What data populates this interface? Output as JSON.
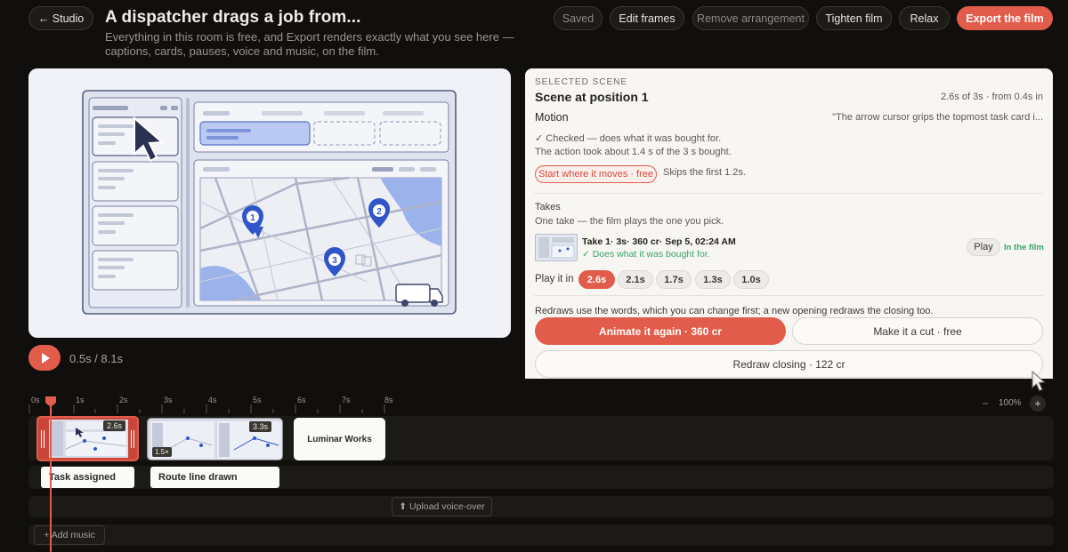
{
  "header": {
    "back_label": "← Studio",
    "title": "A dispatcher drags a job from...",
    "subtitle": "Everything in this room is free, and Export renders exactly what you see here — captions, cards, pauses, voice and music, on the film.",
    "buttons": {
      "saved": "Saved",
      "edit_frames": "Edit frames",
      "remove_arrangement": "Remove arrangement",
      "tighten_film": "Tighten film",
      "relax": "Relax",
      "export": "Export the film"
    }
  },
  "player": {
    "time": "0.5s / 8.1s",
    "map_pins": [
      "1",
      "2",
      "3"
    ]
  },
  "panel": {
    "eyebrow": "SELECTED SCENE",
    "scene_title": "Scene at position 1",
    "scene_meta": "2.6s of 3s · from 0.4s in",
    "motion_label": "Motion",
    "motion_quote": "\"The arrow cursor grips the topmost task card i...",
    "checked": "✓ Checked — does what it was bought for.",
    "action_note": "The action took about 1.4 s of the 3 s bought.",
    "start_where": "Start where it moves · free",
    "skips": "Skips the first 1.2s.",
    "takes_label": "Takes",
    "takes_note": "One take — the film plays the one you pick.",
    "take_title": "Take 1· 3s· 360 cr· Sep 5, 02:24 AM",
    "take_status": "✓ Does what it was bought for.",
    "take_play": "Play",
    "take_in_film": "In the film",
    "play_it_in_label": "Play it in",
    "durations": [
      "2.6s",
      "2.1s",
      "1.7s",
      "1.3s",
      "1.0s"
    ],
    "selected_duration": "2.6s",
    "redraw_note": "Redraws use the words, which you can change first; a new opening redraws the closing too.",
    "animate_again": "Animate it again · 360 cr",
    "make_cut": "Make it a cut · free",
    "redraw_closing": "Redraw closing · 122 cr"
  },
  "timeline": {
    "ticks": [
      "0s",
      "1s",
      "2s",
      "3s",
      "4s",
      "5s",
      "6s",
      "7s",
      "8s"
    ],
    "zoom": "100%",
    "zoom_minus": "−",
    "zoom_plus": "+",
    "clip1_duration": "2.6s",
    "clip2_duration": "3.3s",
    "clip2_speed": "1.5×",
    "card_text": "Luminar Works",
    "captions": [
      "Task assigned",
      "Route line drawn"
    ],
    "upload_voice": "⬆ Upload voice-over",
    "add_music": "+ Add music"
  },
  "colors": {
    "accent": "#e25c4b",
    "background": "#100f0d",
    "panel": "#f7f6f3",
    "success": "#3aa36b",
    "pin": "#2f55c9"
  }
}
